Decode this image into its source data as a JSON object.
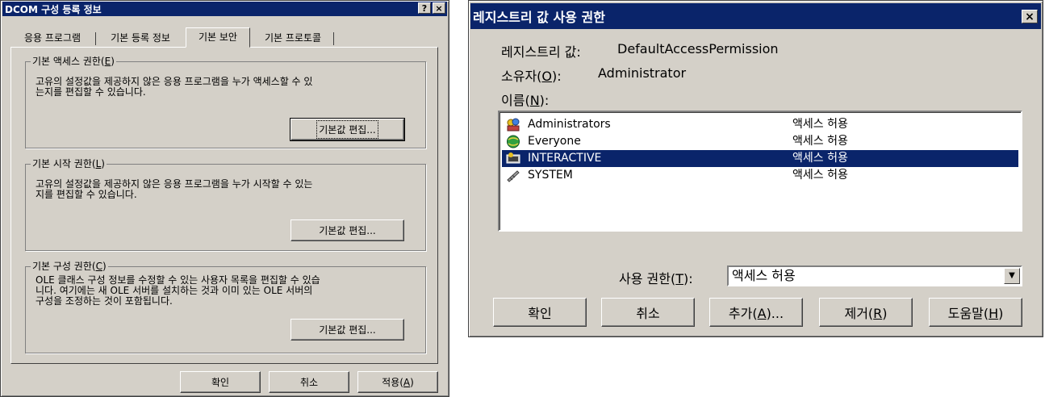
{
  "dcom": {
    "title": "DCOM 구성 등록 정보",
    "title_buttons": {
      "help": "?",
      "close": "×"
    },
    "tabs": [
      {
        "label": "응용 프로그램"
      },
      {
        "label": "기본 등록 정보"
      },
      {
        "label": "기본 보안"
      },
      {
        "label": "기본 프로토콜"
      }
    ],
    "groups": [
      {
        "legend_text": "기본 액세스 권한(",
        "legend_key": "E",
        "legend_end": ")",
        "desc_line1": "고유의 설정값을 제공하지 않은 응용 프로그램을 누가 액세스할 수 있",
        "desc_line2": "는지를 편집할 수 있습니다.",
        "desc_line3": "",
        "button": "기본값 편집..."
      },
      {
        "legend_text": "기본 시작 권한(",
        "legend_key": "L",
        "legend_end": ")",
        "desc_line1": "고유의 설정값을 제공하지 않은 응용 프로그램을 누가 시작할 수 있는",
        "desc_line2": "지를 편집할 수 있습니다.",
        "desc_line3": "",
        "button": "기본값 편집..."
      },
      {
        "legend_text": "기본 구성 권한(",
        "legend_key": "C",
        "legend_end": ")",
        "desc_line1": "OLE 클래스 구성 정보를 수정할 수 있는 사용자 목록을 편집할 수 있습",
        "desc_line2": "니다. 여기에는 새 OLE 서버를 설치하는 것과 이미 있는 OLE 서버의",
        "desc_line3": "구성을 조정하는 것이 포함됩니다.",
        "button": "기본값 편집..."
      }
    ],
    "ok": "확인",
    "cancel": "취소",
    "apply_text": "적용(",
    "apply_key": "A",
    "apply_end": ")"
  },
  "reg": {
    "title": "레지스트리 값 사용 권한",
    "close": "×",
    "value_label": "레지스트리 값:",
    "value": "DefaultAccessPermission",
    "owner_label_text": "소유자(",
    "owner_label_key": "O",
    "owner_label_end": "):",
    "owner": "Administrator",
    "names_label_text": "이름(",
    "names_label_key": "N",
    "names_label_end": "):",
    "entries": [
      {
        "name": "Administrators",
        "perm": "액세스 허용",
        "icon": "group-icon"
      },
      {
        "name": "Everyone",
        "perm": "액세스 허용",
        "icon": "globe-icon"
      },
      {
        "name": "INTERACTIVE",
        "perm": "액세스 허용",
        "icon": "interactive-icon",
        "selected": true
      },
      {
        "name": "SYSTEM",
        "perm": "액세스 허용",
        "icon": "system-icon"
      }
    ],
    "access_label_text": "사용 권한(",
    "access_label_key": "T",
    "access_label_end": "):",
    "access_value": "액세스 허용",
    "buttons": {
      "ok": "확인",
      "cancel": "취소",
      "add_text": "추가(",
      "add_key": "A",
      "add_end": ")...",
      "remove_text": "제거(",
      "remove_key": "R",
      "remove_end": ")",
      "help_text": "도움말(",
      "help_key": "H",
      "help_end": ")"
    }
  }
}
